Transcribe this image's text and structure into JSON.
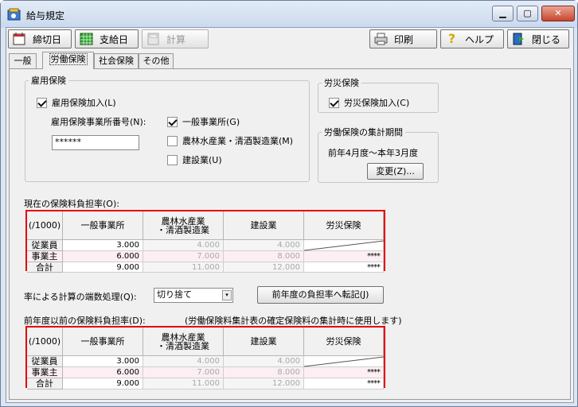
{
  "window": {
    "title": "給与規定"
  },
  "toolbar": {
    "close_date": "締切日",
    "pay_date": "支給日",
    "calc": "計算",
    "print": "印刷",
    "help": "ヘルプ",
    "close": "閉じる"
  },
  "tabs": [
    "一般",
    "労働保険",
    "社会保険",
    "その他"
  ],
  "employment": {
    "legend": "雇用保険",
    "join": "雇用保険加入(L)",
    "office_no_label": "雇用保険事業所番号(N):",
    "office_no_value": "******",
    "general": "一般事業所(G)",
    "agri": "農林水産業・清酒製造業(M)",
    "construction": "建設業(U)"
  },
  "workers_comp": {
    "legend": "労災保険",
    "join": "労災保険加入(C)"
  },
  "period": {
    "legend": "労働保険の集計期間",
    "text": "前年4月度～本年3月度",
    "change": "変更(Z)..."
  },
  "current": {
    "label": "現在の保険料負担率(O):"
  },
  "previous": {
    "label": "前年度以前の保険料負担率(D):",
    "note": "(労働保険料集計表の確定保険料の集計時に使用します)"
  },
  "table": {
    "headers": [
      "(/1000)",
      "一般事業所",
      "農林水産業\n・清酒製造業",
      "建設業",
      "労災保険"
    ],
    "rows": [
      {
        "label": "従業員",
        "general": "3.000",
        "agri": "4.000",
        "construction": "4.000",
        "comp": ""
      },
      {
        "label": "事業主",
        "general": "6.000",
        "agri": "7.000",
        "construction": "8.000",
        "comp": "****"
      },
      {
        "label": "合計",
        "general": "9.000",
        "agri": "11.000",
        "construction": "12.000",
        "comp": "****"
      }
    ]
  },
  "rounding": {
    "label": "率による計算の端数処理(Q):",
    "value": "切り捨て",
    "transfer": "前年度の負担率へ転記(J)"
  }
}
